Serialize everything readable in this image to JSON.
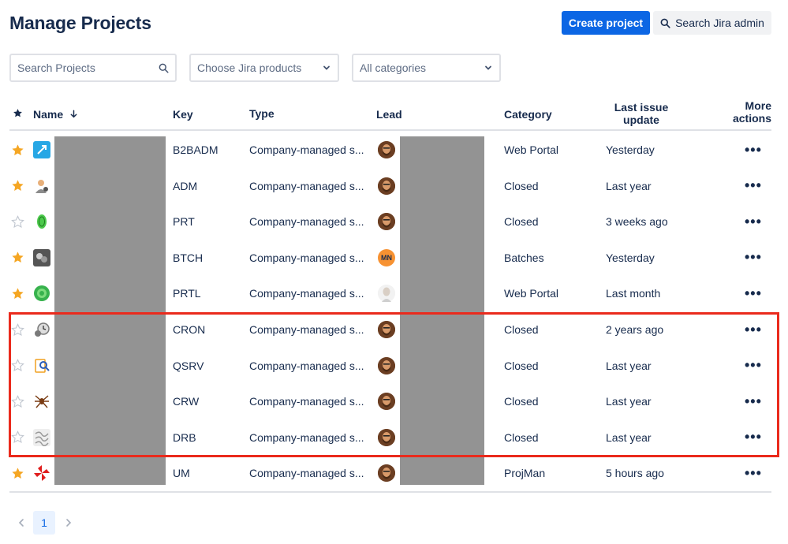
{
  "header": {
    "title": "Manage Projects",
    "create_label": "Create project",
    "search_admin_label": "Search Jira admin"
  },
  "filters": {
    "search_placeholder": "Search Projects",
    "products_label": "Choose Jira products",
    "categories_label": "All categories"
  },
  "table": {
    "columns": {
      "name": "Name",
      "key": "Key",
      "type": "Type",
      "lead": "Lead",
      "category": "Category",
      "last_update_line1": "Last issue",
      "last_update_line2": "update",
      "more_line1": "More",
      "more_line2": "actions"
    },
    "rows": [
      {
        "starred": true,
        "key": "B2BADM",
        "type": "Company-managed s...",
        "lead": "bearded",
        "category": "Web Portal",
        "updated": "Yesterday",
        "icon": "rocket-icon",
        "icon_color": "#27a7e5"
      },
      {
        "starred": true,
        "key": "ADM",
        "type": "Company-managed s...",
        "lead": "bearded",
        "category": "Closed",
        "updated": "Last year",
        "icon": "admin-user-icon",
        "icon_color": "#8c8c8c"
      },
      {
        "starred": false,
        "key": "PRT",
        "type": "Company-managed s...",
        "lead": "bearded",
        "category": "Closed",
        "updated": "3 weeks ago",
        "icon": "fingerprint-icon",
        "icon_color": "#4cc94c"
      },
      {
        "starred": true,
        "key": "BTCH",
        "type": "Company-managed s...",
        "lead": "initials",
        "category": "Batches",
        "updated": "Yesterday",
        "icon": "batch-icon",
        "icon_color": "#555555",
        "lead_initials": "MN"
      },
      {
        "starred": true,
        "key": "PRTL",
        "type": "Company-managed s...",
        "lead": "bald",
        "category": "Web Portal",
        "updated": "Last month",
        "icon": "portal-icon",
        "icon_color": "#37b24d"
      },
      {
        "starred": false,
        "key": "CRON",
        "type": "Company-managed s...",
        "lead": "bearded",
        "category": "Closed",
        "updated": "2 years ago",
        "icon": "clock-gear-icon",
        "icon_color": "#7a7a7a"
      },
      {
        "starred": false,
        "key": "QSRV",
        "type": "Company-managed s...",
        "lead": "bearded",
        "category": "Closed",
        "updated": "Last year",
        "icon": "document-search-icon",
        "icon_color": "#f0a020"
      },
      {
        "starred": false,
        "key": "CRW",
        "type": "Company-managed s...",
        "lead": "bearded",
        "category": "Closed",
        "updated": "Last year",
        "icon": "spider-icon",
        "icon_color": "#7a3b12"
      },
      {
        "starred": false,
        "key": "DRB",
        "type": "Company-managed s...",
        "lead": "bearded",
        "category": "Closed",
        "updated": "Last year",
        "icon": "pattern-icon",
        "icon_color": "#9a9a9a"
      },
      {
        "starred": true,
        "key": "UM",
        "type": "Company-managed s...",
        "lead": "bearded",
        "category": "ProjMan",
        "updated": "5 hours ago",
        "icon": "umbrella-icon",
        "icon_color": "#e01e1e"
      }
    ]
  },
  "pagination": {
    "current_page": "1"
  },
  "colors": {
    "primary": "#0c66e4",
    "star": "#f5a623",
    "highlight": "#ea2a1c"
  }
}
